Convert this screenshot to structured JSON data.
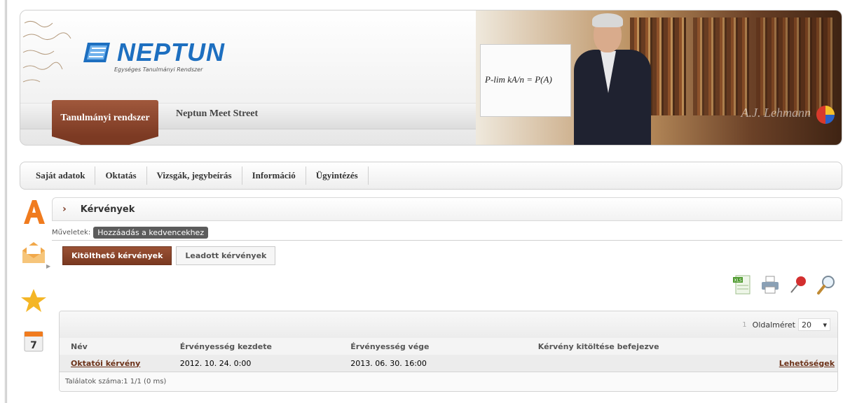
{
  "app": {
    "logo_text": "NEPTUN",
    "logo_subtitle": "Egységes Tanulmányi Rendszer"
  },
  "header_tabs": {
    "active": "Tanulmányi rendszer",
    "other": "Neptun Meet Street"
  },
  "banner": {
    "formula": "P-lim kA/n = P(A)",
    "signature": "A.J. Lehmann"
  },
  "menu": {
    "items": [
      "Saját adatok",
      "Oktatás",
      "Vizsgák, jegybeírás",
      "Információ",
      "Ügyintézés"
    ]
  },
  "sidebar": {
    "icons": [
      "font-icon",
      "mail-icon",
      "star-icon",
      "calendar-icon"
    ],
    "calendar_day": "7"
  },
  "page": {
    "title": "Kérvények",
    "actions_label": "Műveletek:",
    "favorite_button": "Hozzáadás a kedvencekhez",
    "tabs": [
      "Kitölthető kérvények",
      "Leadott kérvények"
    ]
  },
  "toolbar": {
    "icons": [
      "excel-export-icon",
      "print-icon",
      "pin-icon",
      "search-icon"
    ]
  },
  "grid": {
    "page_number": "1",
    "page_size_label": "Oldalméret",
    "page_size_value": "20",
    "columns": [
      "Név",
      "Érvényesség kezdete",
      "Érvényesség vége",
      "Kérvény kitöltése befejezve",
      ""
    ],
    "rows": [
      {
        "name": "Oktatói kérvény",
        "start": "2012. 10. 24. 0:00",
        "end": "2013. 06. 30. 16:00",
        "completed": "",
        "action": "Lehetőségek"
      }
    ],
    "footer": "Találatok száma:1 1/1 (0 ms)"
  },
  "colors": {
    "accent": "#7c3a23",
    "logo_blue": "#1d6fc0"
  }
}
